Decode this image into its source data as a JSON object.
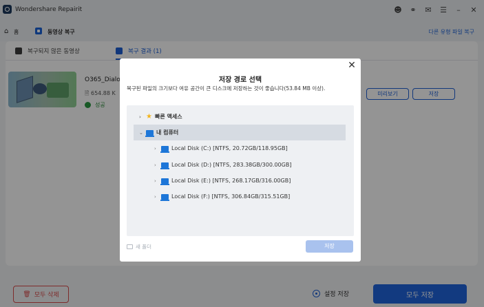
{
  "app": {
    "title": "Wondershare Repairit"
  },
  "titlebar": {
    "icons": [
      "user-icon",
      "headset-icon",
      "chat-icon",
      "menu-icon",
      "minimize-icon",
      "close-icon"
    ]
  },
  "breadcrumb": {
    "home_label": "홈",
    "current_label": "동영상 복구",
    "other_link": "다른 유형 파일 복구"
  },
  "tabs": [
    {
      "label": "복구되지 않은 동영상"
    },
    {
      "label": "복구 결과 (1)"
    }
  ],
  "file": {
    "name": "O365_Dialo",
    "size": "654.88 K",
    "status": "성공",
    "preview_label": "미리보기",
    "save_label": "저장"
  },
  "footer": {
    "delete_all_label": "모두 삭제",
    "settings_save_label": "설정 저장",
    "save_all_label": "모두 저장"
  },
  "dialog": {
    "title": "저장 경로 선택",
    "description": "복구된 파일의 크기보다 여유 공간이 큰 디스크에 저장하는 것이 좋습니다(53.84 MB 이상).",
    "quick_access": "빠른 액세스",
    "my_computer": "내 컴퓨터",
    "disks": [
      "Local Disk (C:) [NTFS, 20.72GB/118.95GB]",
      "Local Disk (D:) [NTFS, 283.38GB/300.00GB]",
      "Local Disk (E:) [NTFS, 268.17GB/316.00GB]",
      "Local Disk (F:) [NTFS, 306.84GB/315.51GB]"
    ],
    "new_folder_label": "새 폴더",
    "save_label": "저장"
  },
  "colors": {
    "accent": "#1f65dc",
    "danger": "#d94b4b",
    "success": "#2a9a43"
  }
}
